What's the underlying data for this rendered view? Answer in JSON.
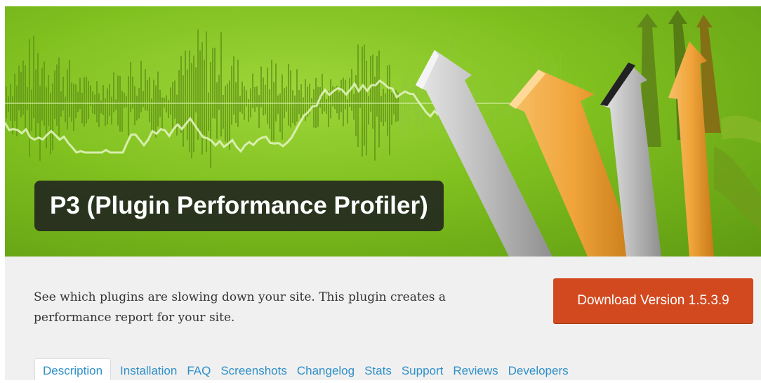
{
  "banner": {
    "title": "P3 (Plugin Performance Profiler)",
    "colors": {
      "background": "#7fc01f",
      "title_box": "#23281e",
      "arrow_orange": "#f0a43a",
      "arrow_gray": "#c8c8c8"
    }
  },
  "plugin": {
    "description": "See which plugins are slowing down your site. This plugin creates a performance report for your site.",
    "download_label": "Download Version 1.5.3.9",
    "download_color": "#d2491f"
  },
  "tabs": [
    {
      "label": "Description",
      "active": true
    },
    {
      "label": "Installation",
      "active": false
    },
    {
      "label": "FAQ",
      "active": false
    },
    {
      "label": "Screenshots",
      "active": false
    },
    {
      "label": "Changelog",
      "active": false
    },
    {
      "label": "Stats",
      "active": false
    },
    {
      "label": "Support",
      "active": false
    },
    {
      "label": "Reviews",
      "active": false
    },
    {
      "label": "Developers",
      "active": false
    }
  ]
}
